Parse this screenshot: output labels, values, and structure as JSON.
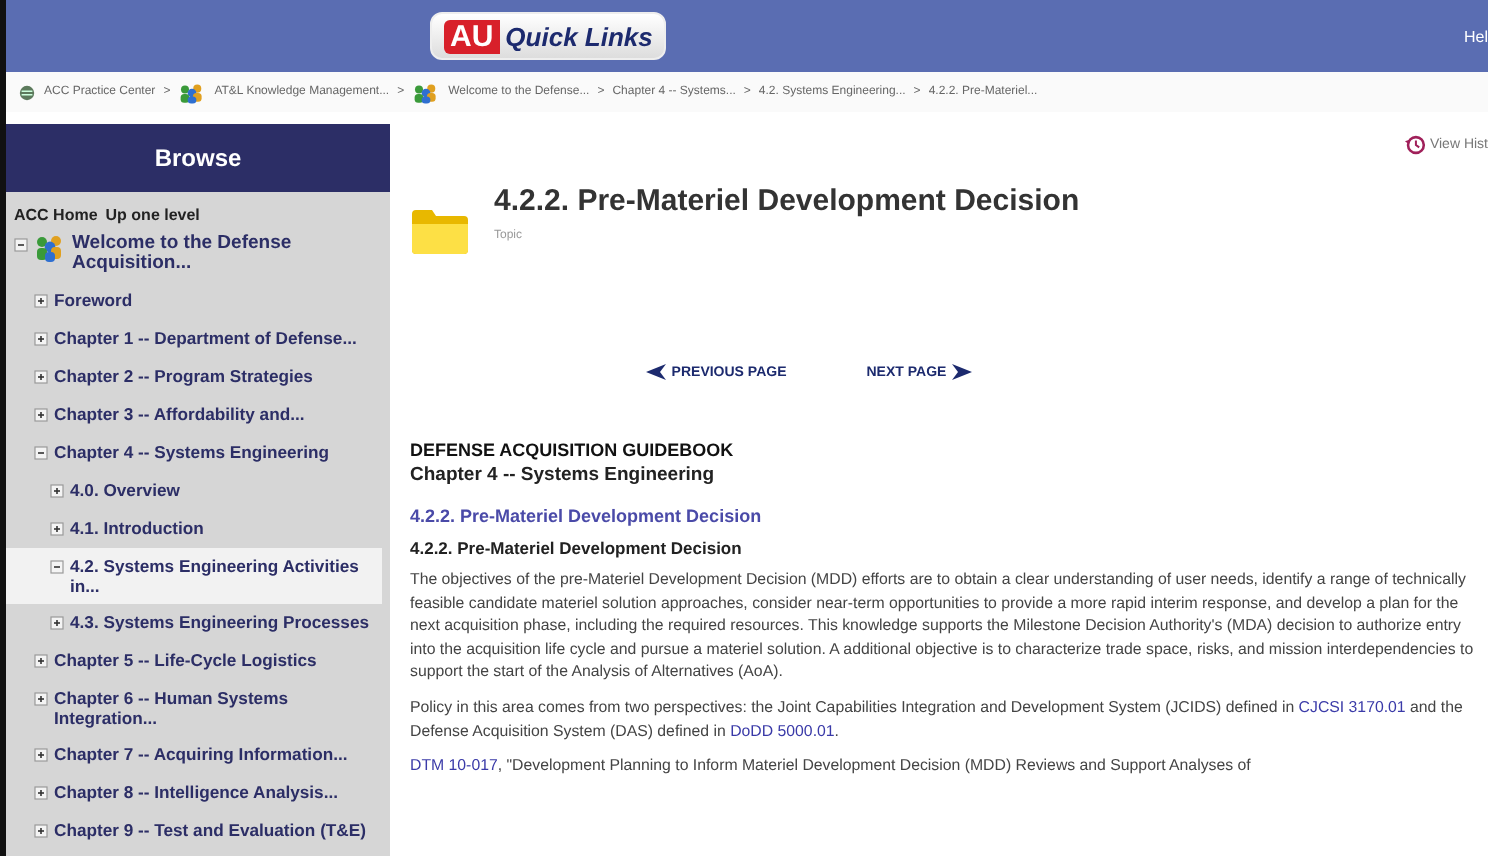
{
  "header": {
    "quick_links": {
      "logo": "AU",
      "label": "Quick Links"
    },
    "right_link": "Hel"
  },
  "breadcrumb": {
    "separator": ">",
    "items": [
      {
        "label": "ACC Practice Center",
        "kind": "globe"
      },
      {
        "label": "AT&L Knowledge Management...",
        "kind": "group"
      },
      {
        "label": "Welcome to the Defense...",
        "kind": "group"
      },
      {
        "label": "Chapter 4 -- Systems...",
        "kind": "plain"
      },
      {
        "label": "4.2. Systems Engineering...",
        "kind": "plain"
      },
      {
        "label": "4.2.2. Pre-Materiel...",
        "kind": "plain"
      }
    ]
  },
  "sidebar": {
    "title": "Browse",
    "links": [
      "ACC Home",
      "Up one level"
    ],
    "tree": [
      {
        "label": "Welcome to the Defense Acquisition...",
        "expanded": true,
        "selected": false,
        "kind": "group",
        "children": [
          {
            "label": "Foreword",
            "expanded": false,
            "selected": false
          },
          {
            "label": "Chapter 1 -- Department of Defense...",
            "expanded": false,
            "selected": false
          },
          {
            "label": "Chapter 2 -- Program Strategies",
            "expanded": false,
            "selected": false
          },
          {
            "label": "Chapter 3 -- Affordability and...",
            "expanded": false,
            "selected": false
          },
          {
            "label": "Chapter 4 -- Systems Engineering",
            "expanded": true,
            "selected": false,
            "children": [
              {
                "label": "4.0. Overview",
                "expanded": false,
                "selected": false
              },
              {
                "label": "4.1. Introduction",
                "expanded": false,
                "selected": false
              },
              {
                "label": "4.2. Systems Engineering Activities in...",
                "expanded": true,
                "selected": true
              },
              {
                "label": "4.3. Systems Engineering Processes",
                "expanded": false,
                "selected": false
              }
            ]
          },
          {
            "label": "Chapter 5 -- Life-Cycle Logistics",
            "expanded": false,
            "selected": false
          },
          {
            "label": "Chapter 6 -- Human Systems Integration...",
            "expanded": false,
            "selected": false
          },
          {
            "label": "Chapter 7 -- Acquiring Information...",
            "expanded": false,
            "selected": false
          },
          {
            "label": "Chapter 8 -- Intelligence Analysis...",
            "expanded": false,
            "selected": false
          },
          {
            "label": "Chapter 9 -- Test and Evaluation (T&E)",
            "expanded": false,
            "selected": false
          }
        ]
      }
    ]
  },
  "content": {
    "view_history": "View Hist",
    "title": "4.2.2. Pre-Materiel Development Decision",
    "type_label": "Topic",
    "pager": {
      "previous": "PREVIOUS PAGE",
      "next": "NEXT PAGE"
    },
    "guidebook": "DEFENSE ACQUISITION GUIDEBOOK",
    "chapter": "Chapter 4 -- Systems Engineering",
    "section_link": "4.2.2. Pre-Materiel Development Decision",
    "section_heading": "4.2.2. Pre-Materiel Development Decision",
    "paragraphs": [
      {
        "parts": [
          {
            "text": "The objectives of the pre-Materiel Development Decision (MDD) efforts are to obtain a clear understanding of user needs, identify a range of technically feasible candidate materiel solution approaches, consider near-term opportunities to provide a more rapid interim response, and develop a plan for the next acquisition phase, including the required resources. This knowledge supports the Milestone Decision Authority's (MDA) decision to authorize entry into the acquisition life cycle and pursue a materiel solution. A additional objective is to characterize trade space, risks, and mission interdependencies to support the start of the Analysis of Alternatives (AoA).",
            "kind": "text"
          }
        ]
      },
      {
        "parts": [
          {
            "text": "Policy in this area comes from two perspectives: the Joint Capabilities Integration and Development System (JCIDS) defined in",
            "kind": "text"
          },
          {
            "text": "CJCSI 3170.01",
            "kind": "link"
          },
          {
            "text": "and the Defense Acquisition System (DAS) defined in",
            "kind": "text"
          },
          {
            "text": "DoDD 5000.01",
            "kind": "link"
          },
          {
            "text": ".",
            "kind": "text"
          }
        ]
      },
      {
        "parts": [
          {
            "text": "DTM 10-017",
            "kind": "link"
          },
          {
            "text": ", \"Development Planning to Inform Materiel Development Decision (MDD) Reviews and Support Analyses of",
            "kind": "text"
          }
        ]
      }
    ]
  }
}
